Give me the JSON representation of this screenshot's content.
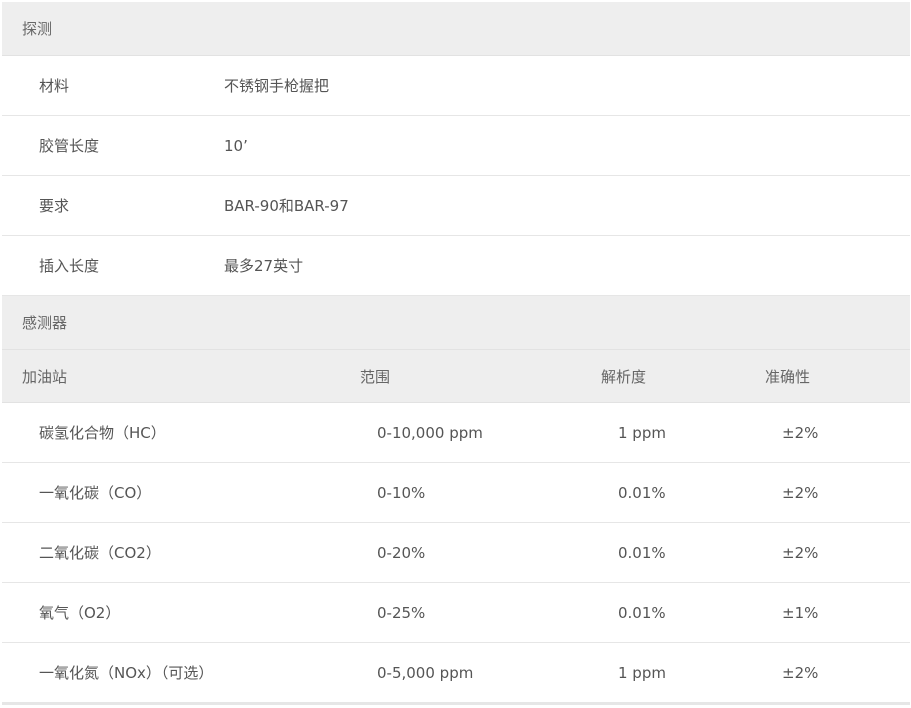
{
  "probe": {
    "section_title": "探测",
    "rows": [
      {
        "label": "材料",
        "value": "不锈钢手枪握把"
      },
      {
        "label": "胶管长度",
        "value": "10’"
      },
      {
        "label": "要求",
        "value": "BAR-90和BAR-97"
      },
      {
        "label": "插入长度",
        "value": "最多27英寸"
      }
    ]
  },
  "sensors": {
    "section_title": "感测器",
    "headers": [
      "加油站",
      "范围",
      "解析度",
      "准确性"
    ],
    "rows": [
      {
        "name": "碳氢化合物（HC）",
        "range": "0-10,000 ppm",
        "resolution": "1 ppm",
        "accuracy": "±2%"
      },
      {
        "name": "一氧化碳（CO）",
        "range": "0-10%",
        "resolution": "0.01%",
        "accuracy": "±2%"
      },
      {
        "name": "二氧化碳（CO2）",
        "range": "0-20%",
        "resolution": "0.01%",
        "accuracy": "±2%"
      },
      {
        "name": "氧气（O2）",
        "range": "0-25%",
        "resolution": "0.01%",
        "accuracy": "±1%"
      },
      {
        "name": "一氧化氮（NOx）（可选）",
        "range": "0-5,000 ppm",
        "resolution": "1 ppm",
        "accuracy": "±2%"
      }
    ]
  }
}
